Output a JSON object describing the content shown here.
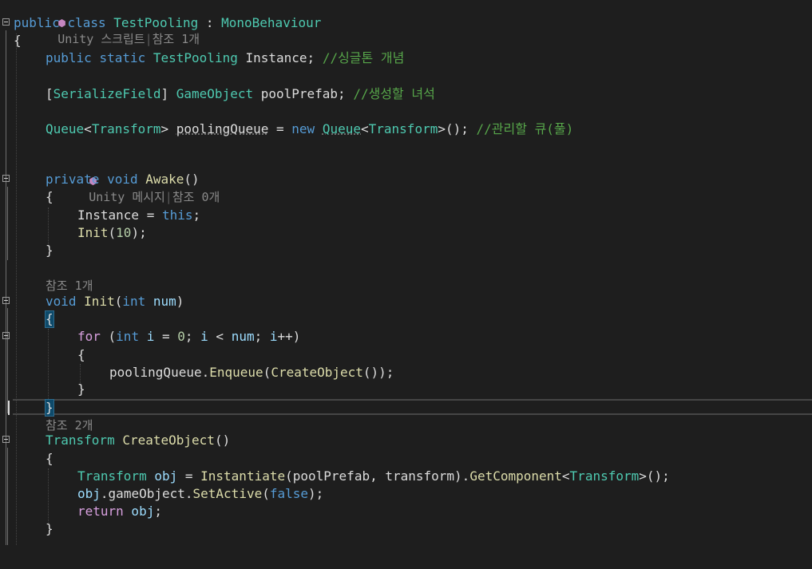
{
  "editor": {
    "lens_unity_script": {
      "icon": "unity-icon",
      "text": "Unity 스크립트",
      "sep": "|",
      "refs": "참조 1개"
    },
    "class_decl": {
      "kw1": "public",
      "kw2": "class",
      "name": "TestPooling",
      "colon": " : ",
      "base": "MonoBehaviour"
    },
    "open_brace_class": "{",
    "line_instance": {
      "kw1": "public",
      "kw2": "static",
      "type": "TestPooling",
      "name": " Instance; ",
      "comment": "//싱글톤 개념"
    },
    "line_serialize": {
      "lb": "[",
      "attr": "SerializeField",
      "rb": "] ",
      "type": "GameObject",
      "name": " poolPrefab; ",
      "comment": "//생성할 녀석"
    },
    "line_queue": {
      "type1": "Queue",
      "lt1": "<",
      "type2": "Transform",
      "gt1": "> ",
      "name": "poolingQueue",
      "eq": " = ",
      "kw": "new",
      "sp": " ",
      "type3": "Queue",
      "lt2": "<",
      "type4": "Transform",
      "gt2": ">(); ",
      "comment": "//관리할 큐(풀)"
    },
    "lens_unity_message": {
      "icon": "unity-icon",
      "text": "Unity 메시지",
      "sep": "|",
      "refs": "참조 0개"
    },
    "awake_decl": {
      "kw1": "private",
      "kw2": "void",
      "name": "Awake",
      "paren": "()"
    },
    "awake_open": "{",
    "awake_line1": {
      "name": "Instance",
      "eq": " = ",
      "kw": "this",
      "semi": ";"
    },
    "awake_line2": {
      "fn": "Init",
      "open": "(",
      "num": "10",
      "close": ");"
    },
    "awake_close": "}",
    "lens_init": "참조 1개",
    "init_decl": {
      "kw1": "void",
      "name": "Init",
      "open": "(",
      "kw2": "int",
      "param": " num",
      "close": ")"
    },
    "init_open": "{",
    "for_line": {
      "kw": "for",
      "open": " (",
      "type": "int",
      "var": " i",
      "eq": " = ",
      "zero": "0",
      "semi1": "; ",
      "var2": "i",
      "lt": " < ",
      "var3": "num",
      "semi2": "; ",
      "var4": "i",
      "inc": "++",
      "close": ")"
    },
    "for_open": "{",
    "enqueue_line": {
      "obj": "poolingQueue",
      "dot": ".",
      "method": "Enqueue",
      "open": "(",
      "fn": "CreateObject",
      "close": "());"
    },
    "for_close": "}",
    "init_close": "}",
    "lens_create": "참조 2개",
    "create_decl": {
      "type": "Transform",
      "name": " CreateObject",
      "paren": "()"
    },
    "create_open": "{",
    "create_line1": {
      "type": "Transform",
      "var": " obj",
      "eq": " = ",
      "fn": "Instantiate",
      "open": "(",
      "arg1": "poolPrefab",
      "comma": ", ",
      "arg2": "transform",
      "close1": ").",
      "method": "GetComponent",
      "lt": "<",
      "type2": "Transform",
      "gt": ">();"
    },
    "create_line2": {
      "obj": "obj",
      "dot1": ".",
      "prop": "gameObject",
      "dot2": ".",
      "method": "SetActive",
      "open": "(",
      "kw": "false",
      "close": ");"
    },
    "create_line3": {
      "kw": "return",
      "var": " obj",
      "semi": ";"
    },
    "create_close": "}"
  },
  "colors": {
    "background": "#1e1e1e",
    "keyword": "#569cd6",
    "control_keyword": "#d8a0df",
    "type": "#4ec9b0",
    "method": "#dcdcaa",
    "variable": "#9cdcfe",
    "comment": "#57a64a",
    "number": "#b5cea8",
    "punctuation": "#dcdcdc",
    "lens": "#8a8a8a"
  }
}
